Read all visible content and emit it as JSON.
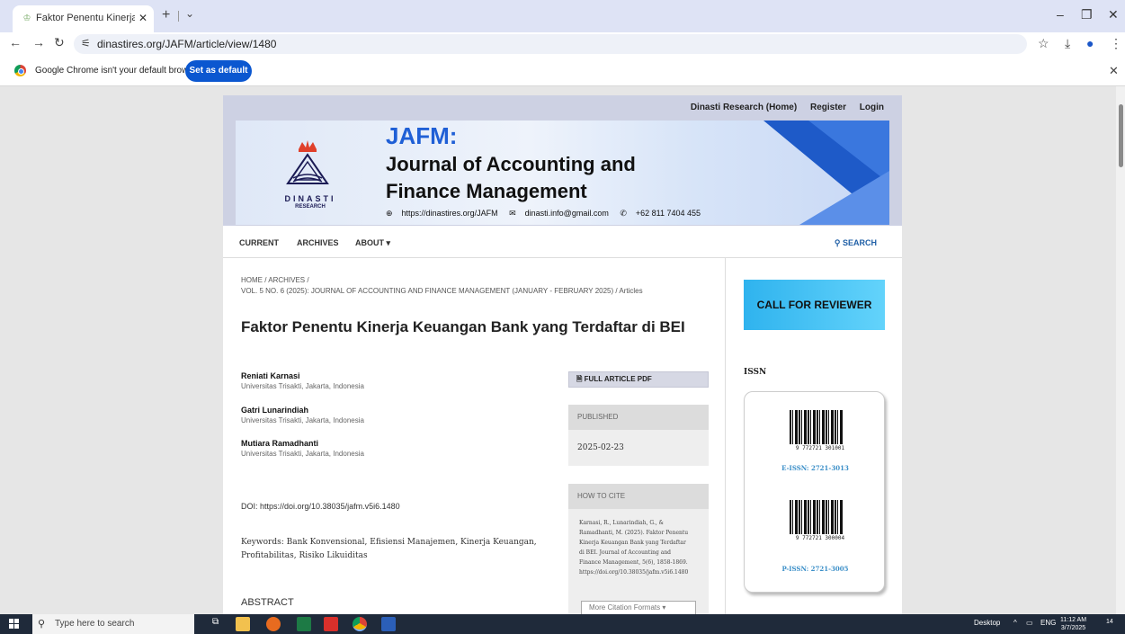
{
  "browser": {
    "tab_title": "Faktor Penentu Kinerja Keuangan",
    "url": "dinastires.org/JAFM/article/view/1480",
    "infobar_text": "Google Chrome isn't your default browser",
    "set_default_label": "Set as default"
  },
  "site": {
    "top_links": [
      "Dinasti Research (Home)",
      "Register",
      "Login"
    ],
    "brand_name": "DINASTI",
    "brand_sub": "RESEARCH",
    "journal_abbr": "JAFM:",
    "journal_line1": "Journal of Accounting and",
    "journal_line2": "Finance Management",
    "contact_web": "https://dinastires.org/JAFM",
    "contact_email": "dinasti.info@gmail.com",
    "contact_phone": "+62 811 7404 455",
    "nav": [
      "CURRENT",
      "ARCHIVES",
      "ABOUT ▾"
    ],
    "search_label": "SEARCH"
  },
  "article": {
    "breadcrumb_home": "HOME",
    "breadcrumb_archives": "ARCHIVES",
    "breadcrumb_issue": "VOL. 5 NO. 6 (2025): JOURNAL OF ACCOUNTING AND FINANCE MANAGEMENT (JANUARY - FEBRUARY 2025)",
    "breadcrumb_current": "Articles",
    "title": "Faktor Penentu Kinerja Keuangan Bank yang Terdaftar di BEI",
    "authors": [
      {
        "name": "Reniati Karnasi",
        "affiliation": "Universitas Trisakti, Jakarta, Indonesia"
      },
      {
        "name": "Gatri Lunarindiah",
        "affiliation": "Universitas Trisakti, Jakarta, Indonesia"
      },
      {
        "name": "Mutiara Ramadhanti",
        "affiliation": "Universitas Trisakti, Jakarta, Indonesia"
      }
    ],
    "pdf_label": "FULL ARTICLE PDF",
    "published_label": "PUBLISHED",
    "published_date": "2025-02-23",
    "how_to_cite_label": "HOW TO CITE",
    "citation_lines": [
      "Karnasi, R., Lunarindiah, G., &",
      "Ramadhanti, M. (2025). Faktor Penentu",
      "Kinerja Keuangan Bank yang Terdaftar",
      "di BEI. Journal of Accounting and",
      "Finance Management, 5(6), 1858-1869.",
      "https://doi.org/10.38035/jafm.v5i6.1480"
    ],
    "citation_formats_label": "More Citation Formats",
    "doi": "DOI: https://doi.org/10.38035/jafm.v5i6.1480",
    "keywords": "Keywords: Bank Konvensional, Efisiensi Manajemen, Kinerja Keuangan, Profitabilitas, Risiko Likuiditas",
    "abstract_label": "ABSTRACT"
  },
  "sidebar": {
    "call_for_reviewer": "CALL FOR REVIEWER",
    "issn_heading": "ISSN",
    "barcode1_digits": "9 772721 301001",
    "eissn": "E-ISSN: 2721-3013",
    "barcode2_digits": "9 772721 300004",
    "pissn": "P-ISSN: 2721-3005"
  },
  "taskbar": {
    "search_placeholder": "Type here to search",
    "desktop_label": "Desktop",
    "lang": "ENG",
    "time": "11:12 AM",
    "date": "3/7/2025",
    "notif_count": "14"
  }
}
